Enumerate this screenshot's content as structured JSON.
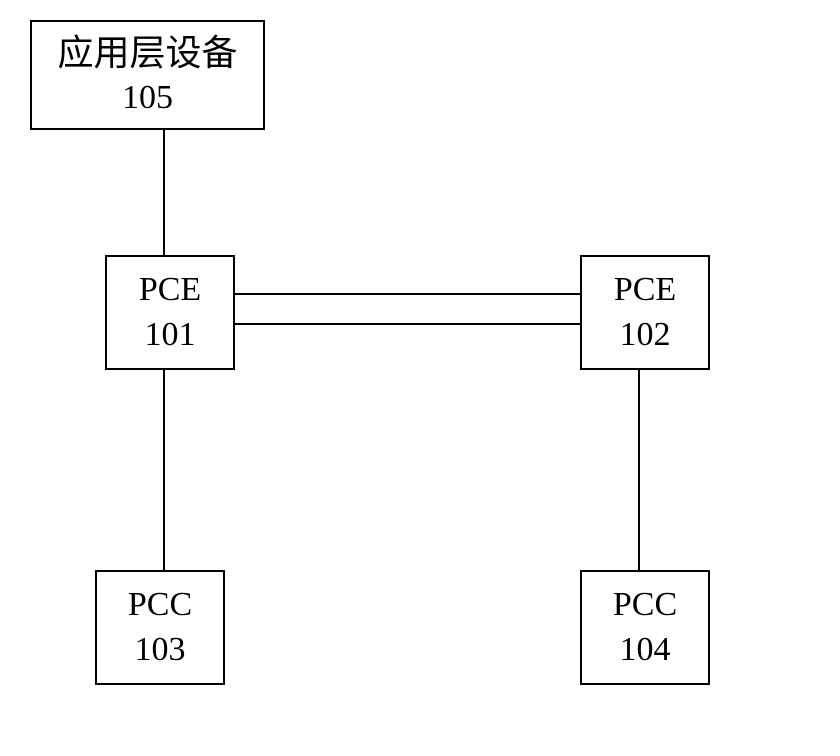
{
  "nodes": {
    "appLayer": {
      "label": "应用层设备",
      "id": "105"
    },
    "pce101": {
      "label": "PCE",
      "id": "101"
    },
    "pce102": {
      "label": "PCE",
      "id": "102"
    },
    "pcc103": {
      "label": "PCC",
      "id": "103"
    },
    "pcc104": {
      "label": "PCC",
      "id": "104"
    }
  }
}
